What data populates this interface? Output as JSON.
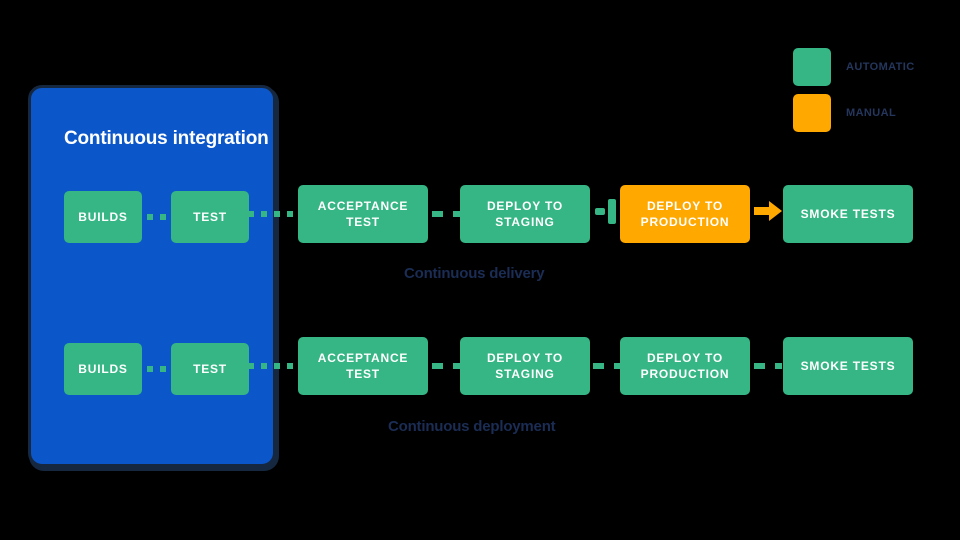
{
  "background_color": "#000000",
  "colors": {
    "automatic_green": "#35b684",
    "manual_orange": "#ffa800",
    "panel_blue": "#0b56c9",
    "panel_border": "#16283f",
    "caption_navy": "#1b2d54",
    "box_text": "#ffffff"
  },
  "legend": {
    "items": [
      {
        "label": "AUTOMATIC",
        "color": "#35b684",
        "swatch_name": "legend-swatch-automatic"
      },
      {
        "label": "MANUAL",
        "color": "#ffa800",
        "swatch_name": "legend-swatch-manual"
      }
    ]
  },
  "ci_panel": {
    "title": "Continuous integration",
    "stages": {
      "row1": [
        {
          "label": "BUILDS"
        },
        {
          "label": "TEST"
        }
      ],
      "row2": [
        {
          "label": "BUILDS"
        },
        {
          "label": "TEST"
        }
      ]
    }
  },
  "pipelines": [
    {
      "id": "continuous-delivery",
      "caption": "Continuous delivery",
      "stages": [
        {
          "label": "ACCEPTANCE TEST",
          "type": "automatic"
        },
        {
          "label": "DEPLOY TO STAGING",
          "type": "automatic"
        },
        {
          "label": "DEPLOY TO PRODUCTION",
          "type": "manual"
        },
        {
          "label": "SMOKE TESTS",
          "type": "automatic"
        }
      ]
    },
    {
      "id": "continuous-deployment",
      "caption": "Continuous deployment",
      "stages": [
        {
          "label": "ACCEPTANCE TEST",
          "type": "automatic"
        },
        {
          "label": "DEPLOY TO STAGING",
          "type": "automatic"
        },
        {
          "label": "DEPLOY TO PRODUCTION",
          "type": "automatic"
        },
        {
          "label": "SMOKE TESTS",
          "type": "automatic"
        }
      ]
    }
  ]
}
